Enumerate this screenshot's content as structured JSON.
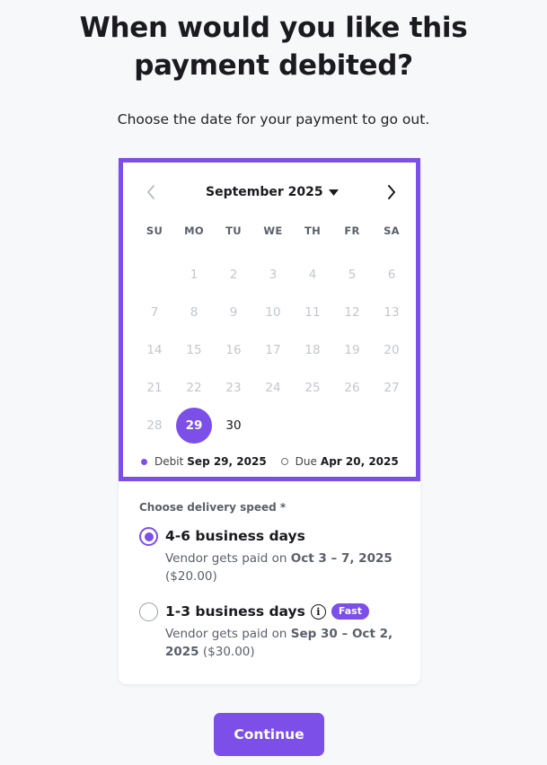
{
  "page": {
    "title": "When would you like this payment debited?",
    "subtitle": "Choose the date for your payment to go out."
  },
  "calendar": {
    "month_label": "September 2025",
    "prev_icon": "chevron-left-icon",
    "next_icon": "chevron-right-icon",
    "dropdown_icon": "caret-down-icon",
    "weekdays": [
      "SU",
      "MO",
      "TU",
      "WE",
      "TH",
      "FR",
      "SA"
    ],
    "leading_blanks": 1,
    "days": [
      "1",
      "2",
      "3",
      "4",
      "5",
      "6",
      "7",
      "8",
      "9",
      "10",
      "11",
      "12",
      "13",
      "14",
      "15",
      "16",
      "17",
      "18",
      "19",
      "20",
      "21",
      "22",
      "23",
      "24",
      "25",
      "26",
      "27",
      "28",
      "29",
      "30"
    ],
    "enabled_days": [
      "29",
      "30"
    ],
    "selected_day": "29",
    "legend": {
      "debit_label": "Debit",
      "debit_date": "Sep 29, 2025",
      "due_label": "Due",
      "due_date": "Apr 20, 2025"
    }
  },
  "delivery": {
    "label": "Choose delivery speed *",
    "options": [
      {
        "title": "4-6 business days",
        "desc_prefix": "Vendor gets paid on",
        "desc_date": "Oct 3 – 7, 2025",
        "desc_price": "($20.00)",
        "checked": true
      },
      {
        "title": "1-3 business days",
        "badge": "Fast",
        "info_icon": "info-icon",
        "desc_prefix": "Vendor gets paid on",
        "desc_date": "Sep 30 – Oct 2, 2025",
        "desc_price": "($30.00)",
        "checked": false
      }
    ]
  },
  "actions": {
    "continue_label": "Continue"
  },
  "colors": {
    "accent": "#7b4fe8",
    "background": "#f7f8fa"
  }
}
